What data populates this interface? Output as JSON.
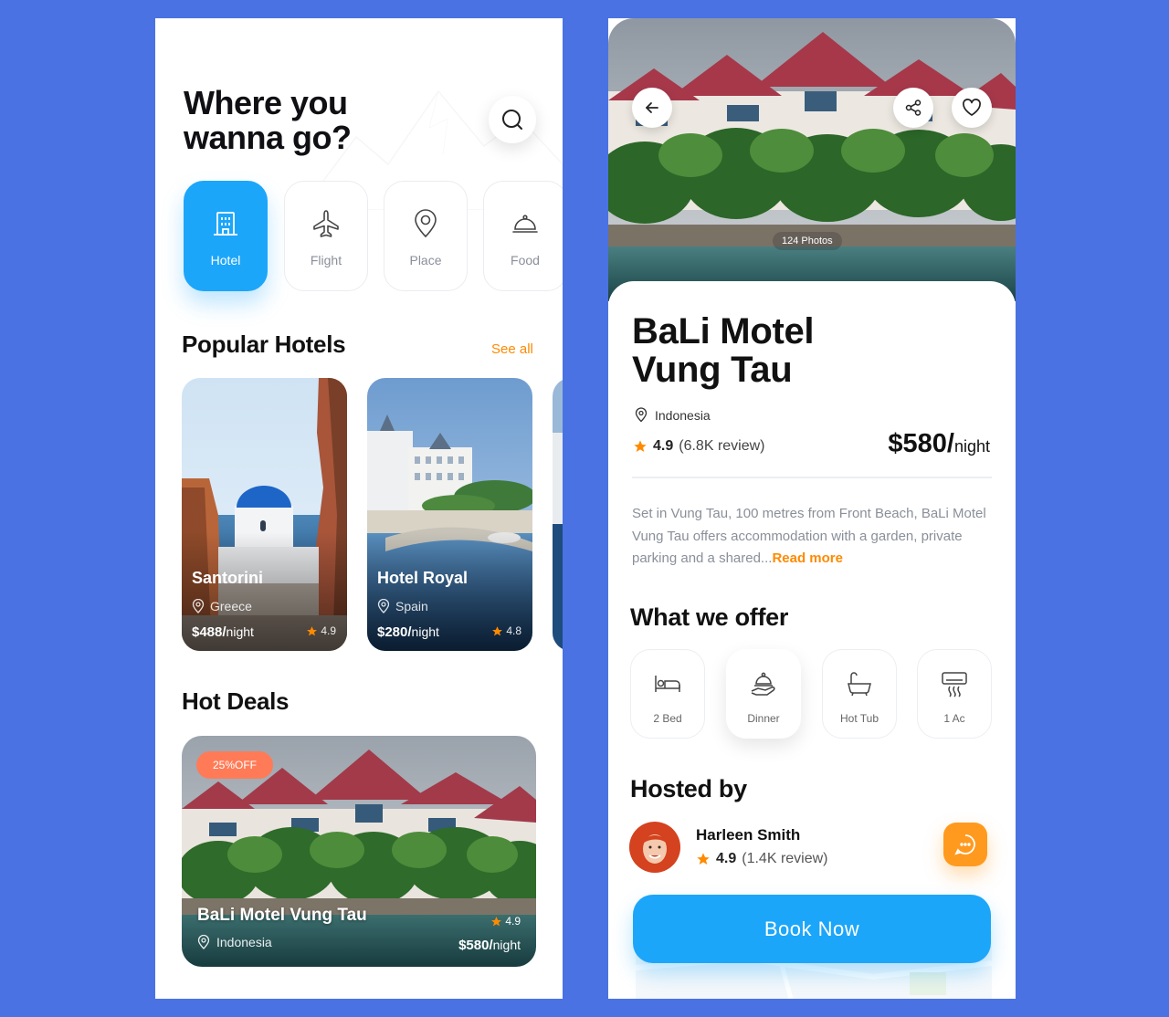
{
  "colors": {
    "background": "#4A72E2",
    "primary": "#1CA6FA",
    "accent": "#FF8A00",
    "badge": "#FF7B57"
  },
  "home": {
    "headline": "Where you\nwanna go?",
    "search_icon": "search-icon",
    "categories": [
      {
        "label": "Hotel",
        "icon": "building-icon",
        "active": true
      },
      {
        "label": "Flight",
        "icon": "airplane-icon",
        "active": false
      },
      {
        "label": "Place",
        "icon": "location-pin-icon",
        "active": false
      },
      {
        "label": "Food",
        "icon": "food-cloche-icon",
        "active": false
      }
    ],
    "popular_title": "Popular Hotels",
    "see_all": "See all",
    "hotels": [
      {
        "name": "Santorini",
        "location": "Greece",
        "price": "$488/",
        "unit": "night",
        "rating": "4.9"
      },
      {
        "name": "Hotel Royal",
        "location": "Spain",
        "price": "$280/",
        "unit": "night",
        "rating": "4.8"
      }
    ],
    "hot_deals_title": "Hot Deals",
    "deal": {
      "badge": "25%OFF",
      "name": "BaLi Motel Vung Tau",
      "location": "Indonesia",
      "rating": "4.9",
      "price": "$580/",
      "unit": "night"
    }
  },
  "detail": {
    "photos": "124 Photos",
    "title": "BaLi Motel\nVung Tau",
    "location": "Indonesia",
    "rating": "4.9",
    "reviews": "(6.8K review)",
    "price": "$580/",
    "price_unit": "night",
    "description": "Set in Vung Tau, 100 metres from Front Beach, BaLi Motel Vung Tau offers accommodation with a garden, private parking and a shared...",
    "read_more": "Read more",
    "offer_title": "What we offer",
    "offers": [
      {
        "label": "2 Bed",
        "icon": "bed-icon"
      },
      {
        "label": "Dinner",
        "icon": "dinner-cloche-icon"
      },
      {
        "label": "Hot Tub",
        "icon": "bathtub-icon"
      },
      {
        "label": "1 Ac",
        "icon": "air-conditioner-icon"
      }
    ],
    "hosted_title": "Hosted by",
    "host": {
      "name": "Harleen Smith",
      "rating": "4.9",
      "reviews": "(1.4K review)"
    },
    "book_button": "Book Now"
  }
}
